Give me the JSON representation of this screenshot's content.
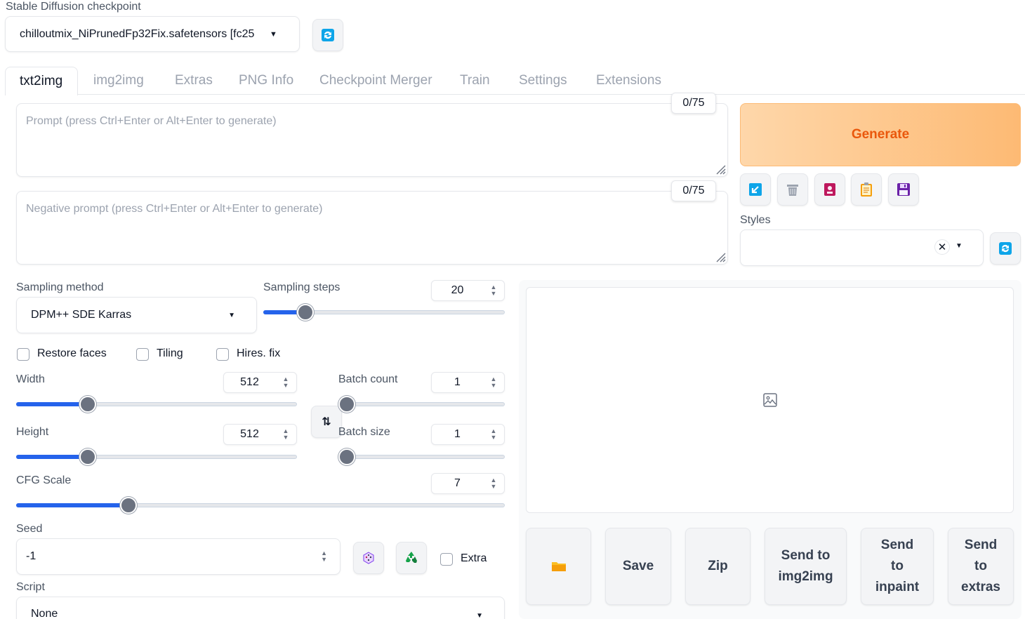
{
  "checkpoint": {
    "label": "Stable Diffusion checkpoint",
    "value": "chilloutmix_NiPrunedFp32Fix.safetensors [fc25",
    "refresh_icon": "refresh-icon"
  },
  "tabs": [
    "txt2img",
    "img2img",
    "Extras",
    "PNG Info",
    "Checkpoint Merger",
    "Train",
    "Settings",
    "Extensions"
  ],
  "active_tab": "txt2img",
  "prompt": {
    "placeholder": "Prompt (press Ctrl+Enter or Alt+Enter to generate)",
    "token_count": "0/75"
  },
  "negative_prompt": {
    "placeholder": "Negative prompt (press Ctrl+Enter or Alt+Enter to generate)",
    "token_count": "0/75"
  },
  "generate": {
    "label": "Generate",
    "color": "#ea580c"
  },
  "tool_icons": [
    "arrow-icon",
    "trash-icon",
    "model-card-icon",
    "clipboard-icon",
    "save-icon"
  ],
  "styles": {
    "label": "Styles",
    "value": ""
  },
  "sampling_method": {
    "label": "Sampling method",
    "value": "DPM++ SDE Karras"
  },
  "sampling_steps": {
    "label": "Sampling steps",
    "value": "20",
    "fraction": 0.15
  },
  "checkboxes": {
    "restore_faces": "Restore faces",
    "tiling": "Tiling",
    "hires_fix": "Hires. fix"
  },
  "width": {
    "label": "Width",
    "value": "512",
    "fraction": 0.24
  },
  "height": {
    "label": "Height",
    "value": "512",
    "fraction": 0.24
  },
  "batch_count": {
    "label": "Batch count",
    "value": "1",
    "fraction": 0.0
  },
  "batch_size": {
    "label": "Batch size",
    "value": "1",
    "fraction": 0.0
  },
  "cfg_scale": {
    "label": "CFG Scale",
    "value": "7",
    "fraction": 0.22
  },
  "seed": {
    "label": "Seed",
    "value": "-1",
    "extra_label": "Extra"
  },
  "script": {
    "label": "Script",
    "value": "None"
  },
  "output_buttons": {
    "folder_icon": "folder-icon",
    "save": "Save",
    "zip": "Zip",
    "send_img2img_1": "Send to",
    "send_img2img_2": "img2img",
    "send_inpaint_1": "Send",
    "send_inpaint_2": "to",
    "send_inpaint_3": "inpaint",
    "send_extras_1": "Send",
    "send_extras_2": "to",
    "send_extras_3": "extras"
  },
  "colors": {
    "accent": "#2563eb",
    "generate_bg": "#fdba74",
    "generate_text": "#ea580c"
  }
}
